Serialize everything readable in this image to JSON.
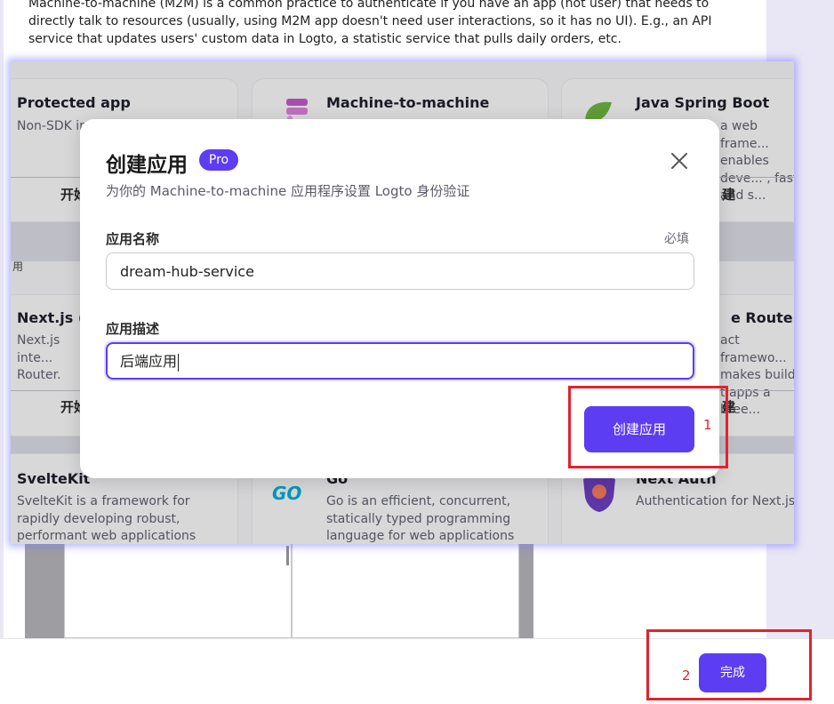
{
  "intro_text": "Machine-to-machine (M2M) is a common practice to authenticate if you have an app (not user) that needs to directly talk to resources (usually, using M2M app doesn't need user interactions, so it has no UI). E.g., an API service that updates users' custom data in Logto, a statistic service that pulls daily orders, etc.",
  "cards": {
    "protected": {
      "title": "Protected app",
      "desc": "Non-SDK in... powered b...",
      "btn": "开始"
    },
    "m2m": {
      "title": "Machine-to-machine"
    },
    "spring": {
      "title": "Java Spring Boot",
      "desc": "a web frame... enables deve... , fast, and s...",
      "btn": "建"
    },
    "nextjs": {
      "title": "Next.js (A",
      "desc": "Next.js inte... Router.",
      "btn": "开始"
    },
    "nextrouter": {
      "title": "e Router)",
      "desc": "act framewo... makes build... t apps a bree...",
      "btn": "建"
    },
    "sveltekit": {
      "title": "SvelteKit",
      "desc": "SvelteKit is a framework for rapidly developing robust, performant web applications usi..."
    },
    "go": {
      "title": "Go",
      "desc": "Go is an efficient, concurrent, statically typed programming language for web applications",
      "logo": "GO"
    },
    "nextauth": {
      "title": "Next Auth",
      "desc": "Authentication for Next.js."
    },
    "side_label": "用"
  },
  "modal": {
    "title": "创建应用",
    "badge": "Pro",
    "subtitle": "为你的 Machine-to-machine 应用程序设置 Logto 身份验证",
    "name_label": "应用名称",
    "required": "必填",
    "name_value": "dream-hub-service",
    "desc_label": "应用描述",
    "desc_value": "后端应用",
    "create_btn": "创建应用"
  },
  "annotations": {
    "n1": "1",
    "n2": "2"
  },
  "footer": {
    "done_btn": "完成"
  },
  "colors": {
    "brand": "#5c3df2",
    "annotation": "#e3222e"
  }
}
